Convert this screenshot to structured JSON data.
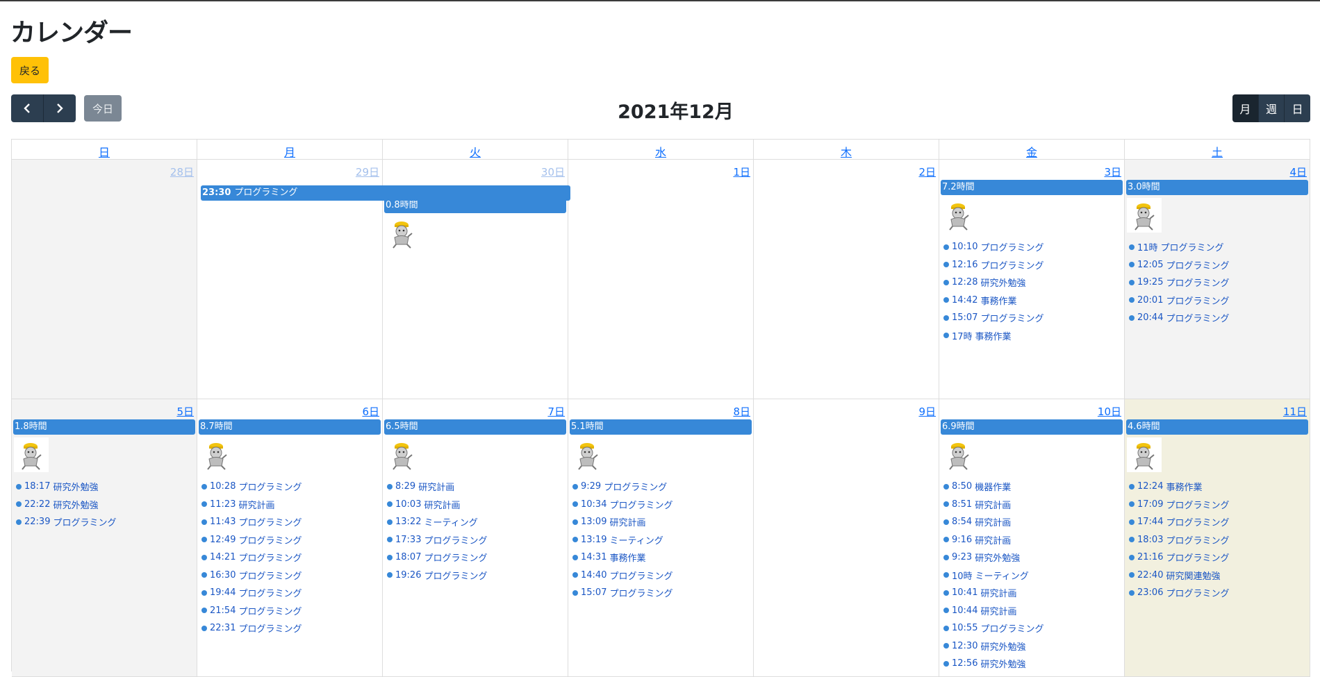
{
  "page": {
    "title": "カレンダー",
    "back_label": "戻る"
  },
  "toolbar": {
    "title": "2021年12月",
    "today_label": "今日",
    "views": [
      "月",
      "週",
      "日"
    ],
    "active_view": "月"
  },
  "colors": {
    "event": "#3788d8",
    "nav_button": "#2c3e50",
    "back_button": "#ffc107",
    "today_cell": "#f2f0df",
    "other_month": "#f3f3f3"
  },
  "calendar": {
    "dow": [
      "日",
      "月",
      "火",
      "水",
      "木",
      "金",
      "土"
    ],
    "spanning_event": {
      "time": "23:30",
      "title": "プログラミング"
    },
    "weeks": [
      {
        "days": [
          {
            "label": "28日",
            "muted": true
          },
          {
            "label": "29日",
            "muted": true
          },
          {
            "label": "30日",
            "muted": true,
            "bar": "0.8時間",
            "image": true
          },
          {
            "label": "1日"
          },
          {
            "label": "2日"
          },
          {
            "label": "3日",
            "bar": "7.2時間",
            "image": true,
            "events": [
              {
                "time": "10:10",
                "title": "プログラミング"
              },
              {
                "time": "12:16",
                "title": "プログラミング"
              },
              {
                "time": "12:28",
                "title": "研究外勉強"
              },
              {
                "time": "14:42",
                "title": "事務作業"
              },
              {
                "time": "15:07",
                "title": "プログラミング"
              },
              {
                "time": "17時",
                "title": "事務作業"
              }
            ]
          },
          {
            "label": "4日",
            "bar": "3.0時間",
            "image": true,
            "events": [
              {
                "time": "11時",
                "title": "プログラミング"
              },
              {
                "time": "12:05",
                "title": "プログラミング"
              },
              {
                "time": "19:25",
                "title": "プログラミング"
              },
              {
                "time": "20:01",
                "title": "プログラミング"
              },
              {
                "time": "20:44",
                "title": "プログラミング"
              }
            ]
          }
        ]
      },
      {
        "days": [
          {
            "label": "5日",
            "bar": "1.8時間",
            "image": true,
            "events": [
              {
                "time": "18:17",
                "title": "研究外勉強"
              },
              {
                "time": "22:22",
                "title": "研究外勉強"
              },
              {
                "time": "22:39",
                "title": "プログラミング"
              }
            ]
          },
          {
            "label": "6日",
            "bar": "8.7時間",
            "image": true,
            "events": [
              {
                "time": "10:28",
                "title": "プログラミング"
              },
              {
                "time": "11:23",
                "title": "研究計画"
              },
              {
                "time": "11:43",
                "title": "プログラミング"
              },
              {
                "time": "12:49",
                "title": "プログラミング"
              },
              {
                "time": "14:21",
                "title": "プログラミング"
              },
              {
                "time": "16:30",
                "title": "プログラミング"
              },
              {
                "time": "19:44",
                "title": "プログラミング"
              },
              {
                "time": "21:54",
                "title": "プログラミング"
              },
              {
                "time": "22:31",
                "title": "プログラミング"
              }
            ]
          },
          {
            "label": "7日",
            "bar": "6.5時間",
            "image": true,
            "events": [
              {
                "time": "8:29",
                "title": "研究計画"
              },
              {
                "time": "10:03",
                "title": "研究計画"
              },
              {
                "time": "13:22",
                "title": "ミーティング"
              },
              {
                "time": "17:33",
                "title": "プログラミング"
              },
              {
                "time": "18:07",
                "title": "プログラミング"
              },
              {
                "time": "19:26",
                "title": "プログラミング"
              }
            ]
          },
          {
            "label": "8日",
            "bar": "5.1時間",
            "image": true,
            "events": [
              {
                "time": "9:29",
                "title": "プログラミング"
              },
              {
                "time": "10:34",
                "title": "プログラミング"
              },
              {
                "time": "13:09",
                "title": "研究計画"
              },
              {
                "time": "13:19",
                "title": "ミーティング"
              },
              {
                "time": "14:31",
                "title": "事務作業"
              },
              {
                "time": "14:40",
                "title": "プログラミング"
              },
              {
                "time": "15:07",
                "title": "プログラミング"
              }
            ]
          },
          {
            "label": "9日"
          },
          {
            "label": "10日",
            "bar": "6.9時間",
            "image": true,
            "events": [
              {
                "time": "8:50",
                "title": "機器作業"
              },
              {
                "time": "8:51",
                "title": "研究計画"
              },
              {
                "time": "8:54",
                "title": "研究計画"
              },
              {
                "time": "9:16",
                "title": "研究計画"
              },
              {
                "time": "9:23",
                "title": "研究外勉強"
              },
              {
                "time": "10時",
                "title": "ミーティング"
              },
              {
                "time": "10:41",
                "title": "研究計画"
              },
              {
                "time": "10:44",
                "title": "研究計画"
              },
              {
                "time": "10:55",
                "title": "プログラミング"
              },
              {
                "time": "12:30",
                "title": "研究外勉強"
              },
              {
                "time": "12:56",
                "title": "研究外勉強"
              }
            ]
          },
          {
            "label": "11日",
            "today": true,
            "bar": "4.6時間",
            "image": true,
            "events": [
              {
                "time": "12:24",
                "title": "事務作業"
              },
              {
                "time": "17:09",
                "title": "プログラミング"
              },
              {
                "time": "17:44",
                "title": "プログラミング"
              },
              {
                "time": "18:03",
                "title": "プログラミング"
              },
              {
                "time": "21:16",
                "title": "プログラミング"
              },
              {
                "time": "22:40",
                "title": "研究関連勉強"
              },
              {
                "time": "23:06",
                "title": "プログラミング"
              }
            ]
          }
        ]
      }
    ]
  }
}
